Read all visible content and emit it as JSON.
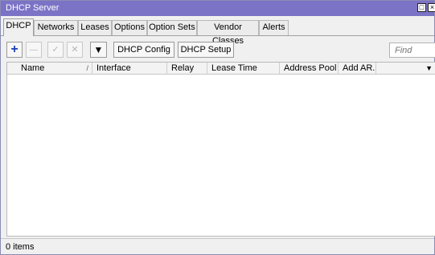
{
  "window": {
    "title": "DHCP Server"
  },
  "tabs": [
    {
      "label": "DHCP"
    },
    {
      "label": "Networks"
    },
    {
      "label": "Leases"
    },
    {
      "label": "Options"
    },
    {
      "label": "Option Sets"
    },
    {
      "label": "Vendor Classes"
    },
    {
      "label": "Alerts"
    }
  ],
  "toolbar": {
    "add_symbol": "+",
    "remove_symbol": "—",
    "enable_symbol": "✓",
    "disable_symbol": "✕",
    "filter_symbol": "▼",
    "dhcp_config_label": "DHCP Config",
    "dhcp_setup_label": "DHCP Setup",
    "find_placeholder": "Find"
  },
  "table": {
    "columns": [
      {
        "label": "Name",
        "sort": "/"
      },
      {
        "label": "Interface"
      },
      {
        "label": "Relay"
      },
      {
        "label": "Lease Time"
      },
      {
        "label": "Address Pool"
      },
      {
        "label": "Add AR..."
      }
    ],
    "rows": []
  },
  "status": {
    "text": "0 items"
  },
  "colors": {
    "titlebar": "#7b73c6",
    "add_icon": "#1a3fb5"
  }
}
